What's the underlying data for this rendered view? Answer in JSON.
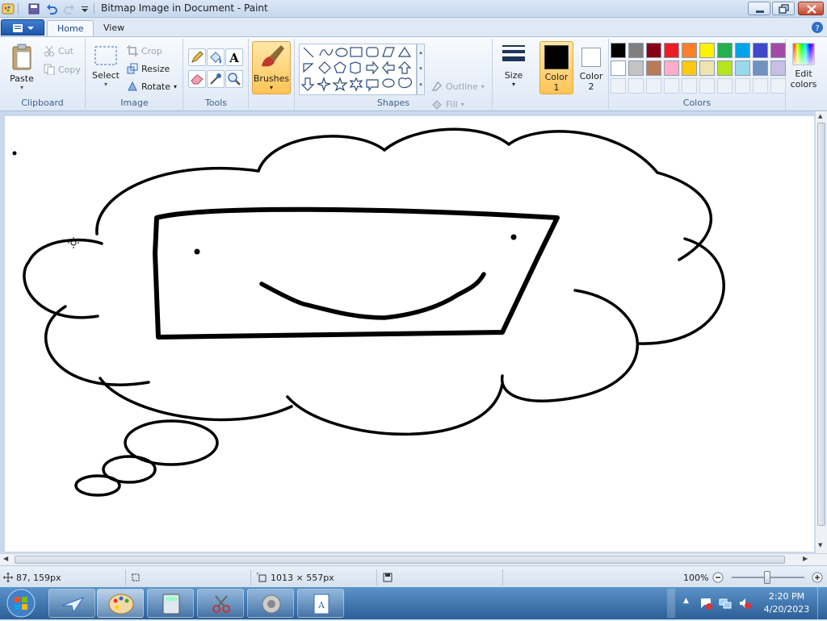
{
  "window": {
    "title": "Bitmap Image in Document - Paint"
  },
  "tabs": {
    "file_menu": "",
    "home": "Home",
    "view": "View"
  },
  "ribbon": {
    "clipboard": {
      "label": "Clipboard",
      "paste": "Paste",
      "cut": "Cut",
      "copy": "Copy"
    },
    "image": {
      "label": "Image",
      "select": "Select",
      "crop": "Crop",
      "resize": "Resize",
      "rotate": "Rotate"
    },
    "tools": {
      "label": "Tools"
    },
    "brushes": {
      "label": "Brushes"
    },
    "shapes": {
      "label": "Shapes",
      "outline": "Outline",
      "fill": "Fill"
    },
    "size": {
      "label": "Size"
    },
    "color1": {
      "label": "Color",
      "num": "1",
      "value": "#000000"
    },
    "color2": {
      "label": "Color",
      "num": "2",
      "value": "#ffffff"
    },
    "colors": {
      "label": "Colors",
      "edit_label": "Edit",
      "edit_label2": "colors",
      "row1": [
        "#000000",
        "#7f7f7f",
        "#880015",
        "#ed1c24",
        "#ff7f27",
        "#fff200",
        "#22b14c",
        "#00a2e8",
        "#3f48cc",
        "#a349a4"
      ],
      "row2": [
        "#ffffff",
        "#c3c3c3",
        "#b97a57",
        "#ffaec9",
        "#ffc90e",
        "#efe4b0",
        "#b5e61d",
        "#99d9ea",
        "#7092be",
        "#c8bfe7"
      ]
    }
  },
  "status": {
    "cursor_pos": "87, 159px",
    "canvas_size": "1013 × 557px",
    "zoom": "100%"
  },
  "taskbar": {
    "time": "2:20 PM",
    "date": "4/20/2023"
  },
  "icons": [
    "paint-app-icon",
    "save-icon",
    "undo-icon",
    "redo-icon",
    "cut-icon",
    "copy-icon",
    "crop-icon",
    "resize-icon",
    "rotate-icon",
    "pencil-icon",
    "fill-icon",
    "text-icon",
    "eraser-icon",
    "color-picker-icon",
    "magnifier-icon",
    "brush-icon",
    "size-icon",
    "edit-colors-icon",
    "help-icon",
    "start-icon"
  ]
}
